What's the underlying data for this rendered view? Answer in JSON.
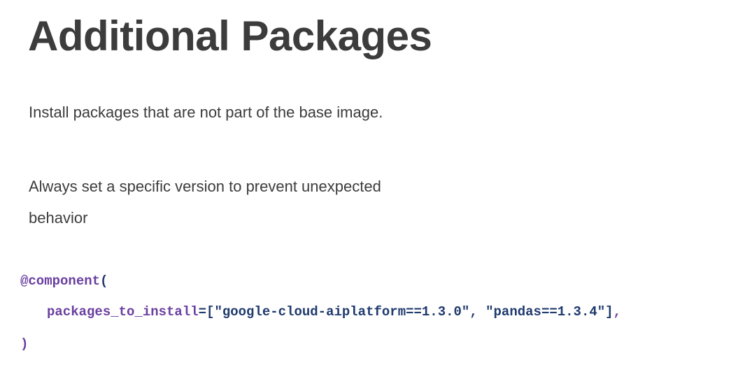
{
  "slide": {
    "title": "Additional Packages",
    "paragraphs": [
      "Install packages that are not part of the base image.",
      "Always set a specific version to prevent unexpected behavior"
    ],
    "code": {
      "decorator": "@component",
      "open_paren": "(",
      "param_name": "packages_to_install",
      "assign_open": "=[",
      "package_1": "\"google-cloud-aiplatform==1.3.0\"",
      "separator": ", ",
      "package_2": "\"pandas==1.3.4\"",
      "close_bracket": "]",
      "trailing_comma": ",",
      "close_paren": ")"
    }
  }
}
